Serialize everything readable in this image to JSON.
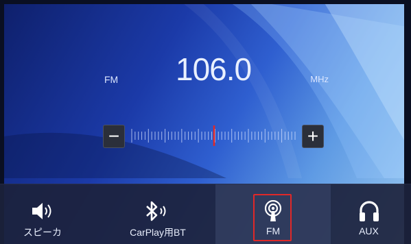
{
  "radio": {
    "band": "FM",
    "frequency": "106.0",
    "unit": "MHz"
  },
  "tuner": {
    "minus_label": "−",
    "plus_label": "+"
  },
  "nav": {
    "items": [
      {
        "label": "スピーカ",
        "icon": "speaker-icon"
      },
      {
        "label": "CarPlay用BT",
        "icon": "bluetooth-icon"
      },
      {
        "label": "FM",
        "icon": "radio-icon",
        "selected": true
      },
      {
        "label": "AUX",
        "icon": "headphones-icon"
      }
    ]
  },
  "colors": {
    "indicator": "#e02828",
    "highlight_border": "#e02828"
  }
}
